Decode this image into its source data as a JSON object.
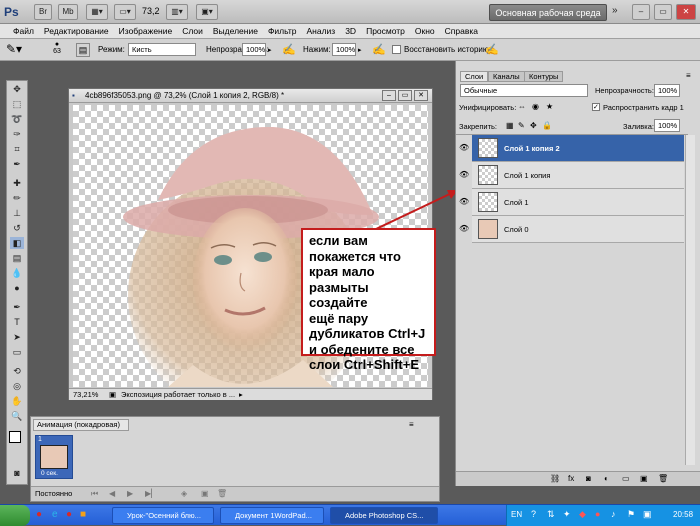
{
  "app": {
    "logo": "Ps",
    "zoom": "73,2",
    "workspace": "Основная рабочая среда"
  },
  "menu": [
    "Файл",
    "Редактирование",
    "Изображение",
    "Слои",
    "Выделение",
    "Фильтр",
    "Анализ",
    "3D",
    "Просмотр",
    "Окно",
    "Справка"
  ],
  "options": {
    "brush_size": "63",
    "mode_label": "Режим:",
    "mode_value": "Кисть",
    "opacity_label": "Непрозрачность:",
    "opacity_value": "100%",
    "pressure_label": "Нажим:",
    "pressure_value": "100%",
    "history_label": "Восстановить историю"
  },
  "document": {
    "title": "4cb896f35053.png @ 73,2% (Слой 1 копия 2, RGB/8) *",
    "zoom": "73,21%",
    "status": "Экспозиция работает только в ..."
  },
  "callout": {
    "text": "если вам\nпокажется что\nкрая мало\nразмыты создайте\nещё пару\nдубликатов Ctrl+J\nи обедените все\nслои Ctrl+Shift+E"
  },
  "animation": {
    "tab": "Анимация (покадровая)",
    "frame_number": "1",
    "frame_time": "0 сек.",
    "loop": "Постоянно"
  },
  "layers_panel": {
    "tabs": [
      "Слои",
      "Каналы",
      "Контуры"
    ],
    "blend_mode": "Обычные",
    "opacity_label": "Непрозрачность:",
    "opacity_value": "100%",
    "unify_label": "Унифицировать:",
    "propagate_label": "Распространить кадр 1",
    "lock_label": "Закрепить:",
    "fill_label": "Заливка:",
    "fill_value": "100%",
    "layers": [
      {
        "name": "Слой 1 копия 2",
        "selected": true
      },
      {
        "name": "Слой 1 копия",
        "selected": false
      },
      {
        "name": "Слой 1",
        "selected": false
      },
      {
        "name": "Слой 0",
        "selected": false
      }
    ]
  },
  "taskbar": {
    "start": "",
    "tasks": [
      "Урок-\"Осенний блю...",
      "Документ 1WordPad...",
      "Adobe Photoshop CS..."
    ],
    "lang": "EN",
    "time": "20:58"
  },
  "colors": {
    "selection_blue": "#3663a9",
    "callout_border": "#c41c1c",
    "taskbar_blue": "#245fd6"
  }
}
